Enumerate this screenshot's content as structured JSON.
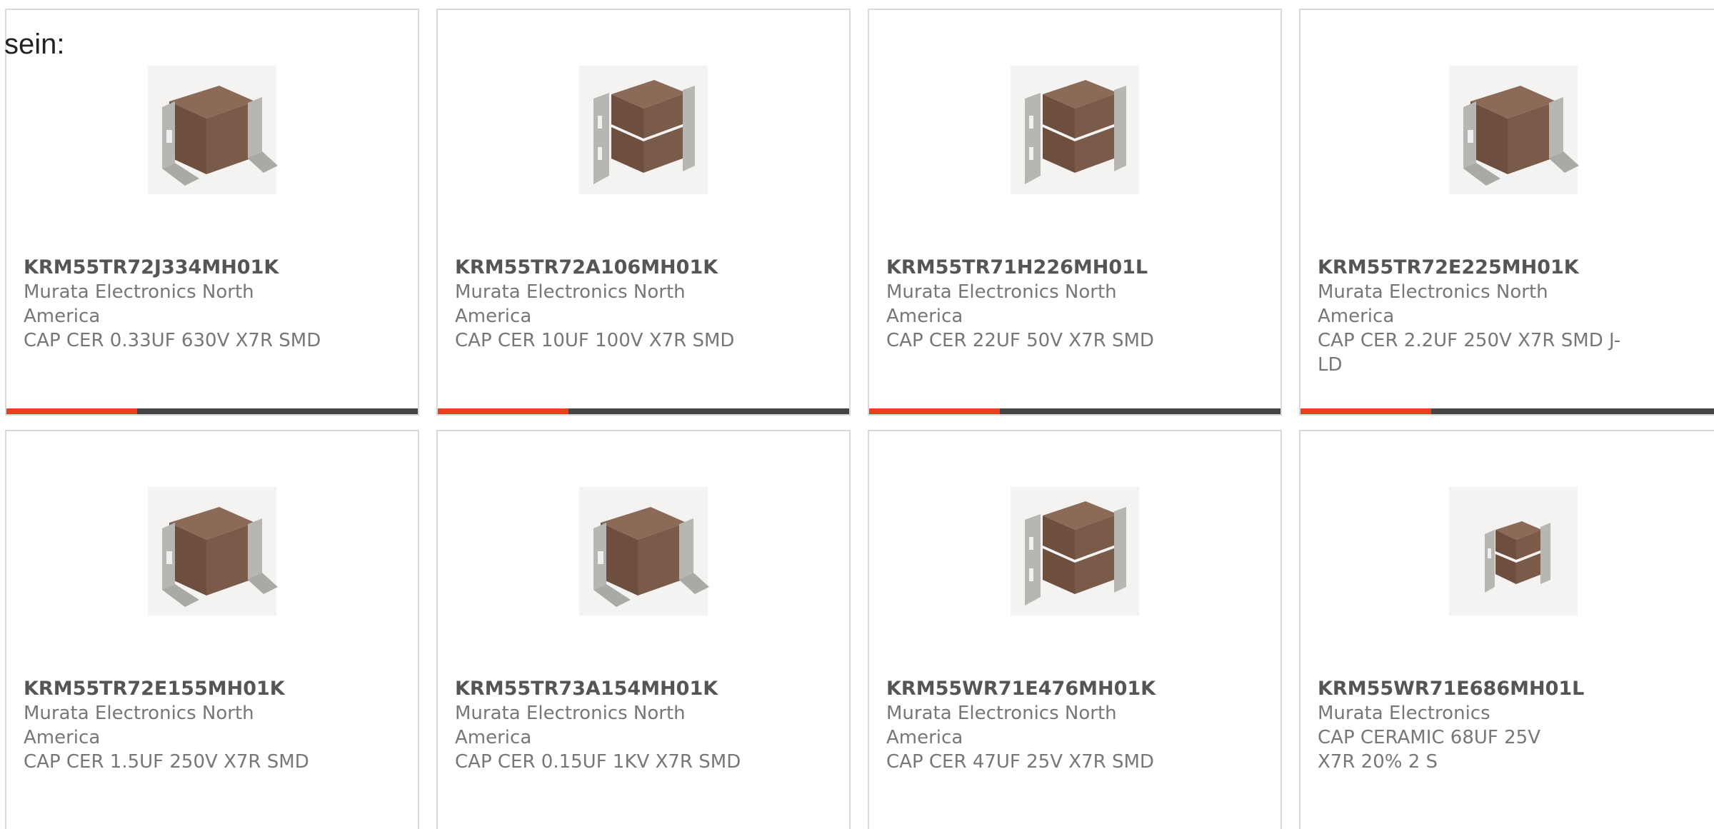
{
  "prefix_text": "sein:",
  "colors": {
    "accent": "#e8401c",
    "bar": "#444444",
    "border": "#d9d9d9",
    "part_number": "#555555",
    "body_text": "#777777",
    "capacitor_body": "#7a5a48",
    "terminal_metal": "#a9a9a6"
  },
  "products": [
    {
      "part_number": "KRM55TR72J334MH01K",
      "manufacturer": "Murata Electronics North America",
      "description": "CAP CER 0.33UF 630V X7R SMD",
      "image_icon": "capacitor-single-icon"
    },
    {
      "part_number": "KRM55TR72A106MH01K",
      "manufacturer": "Murata Electronics North America",
      "description": "CAP CER 10UF 100V X7R SMD",
      "image_icon": "capacitor-stacked-icon"
    },
    {
      "part_number": "KRM55TR71H226MH01L",
      "manufacturer": "Murata Electronics North America",
      "description": "CAP CER 22UF 50V X7R SMD",
      "image_icon": "capacitor-stacked-icon"
    },
    {
      "part_number": "KRM55TR72E225MH01K",
      "manufacturer": "Murata Electronics North America",
      "description": "CAP CER 2.2UF 250V X7R SMD J-LD",
      "image_icon": "capacitor-single-icon"
    },
    {
      "part_number": "KRM55TR72E155MH01K",
      "manufacturer": "Murata Electronics North America",
      "description": "CAP CER 1.5UF 250V X7R SMD",
      "image_icon": "capacitor-single-icon"
    },
    {
      "part_number": "KRM55TR73A154MH01K",
      "manufacturer": "Murata Electronics North America",
      "description": "CAP CER 0.15UF 1KV X7R SMD",
      "image_icon": "capacitor-single-icon"
    },
    {
      "part_number": "KRM55WR71E476MH01K",
      "manufacturer": "Murata Electronics North America",
      "description": "CAP CER 47UF 25V X7R SMD",
      "image_icon": "capacitor-stacked-icon"
    },
    {
      "part_number": "KRM55WR71E686MH01L",
      "manufacturer": "Murata Electronics",
      "description": "CAP CERAMIC 68UF 25V X7R 20% 2 S",
      "image_icon": "capacitor-small-stacked-icon"
    }
  ]
}
